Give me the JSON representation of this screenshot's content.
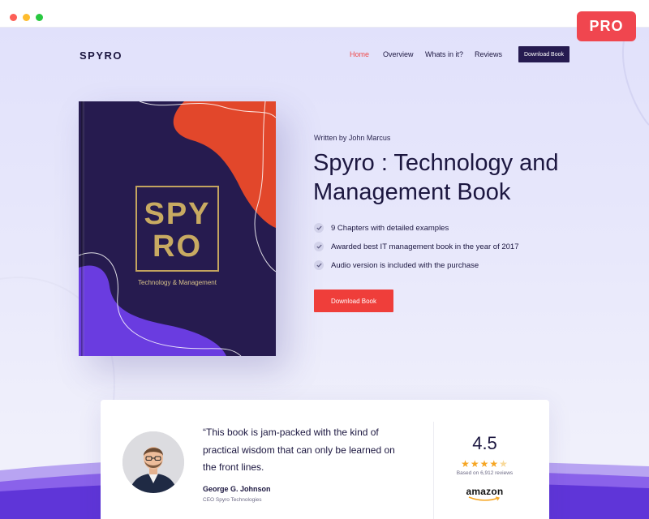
{
  "window": {
    "badge": "PRO"
  },
  "nav": {
    "logo": "SPYRO",
    "links": [
      {
        "label": "Home",
        "active": true
      },
      {
        "label": "Overview",
        "active": false
      },
      {
        "label": "Whats in it?",
        "active": false
      },
      {
        "label": "Reviews",
        "active": false
      }
    ],
    "cta_label": "Download Book"
  },
  "book": {
    "title_line1": "SPY",
    "title_line2": "RO",
    "subtitle": "Technology & Management"
  },
  "hero": {
    "written_by": "Written by John Marcus",
    "title": "Spyro : Technology and Management Book",
    "features": [
      "9 Chapters with detailed examples",
      "Awarded best IT management book in the year of 2017",
      "Audio version is included with the purchase"
    ],
    "cta_label": "Download Book"
  },
  "testimonial": {
    "quote": "“This book is jam-packed with the kind of practical wisdom that can only be learned on the front lines.",
    "author_name": "George G. Johnson",
    "author_role": "CEO Spyro Technologies",
    "rating": "4.5",
    "rating_value": 4.5,
    "rating_max": 5,
    "review_count": "Based on 6,912 reviews",
    "brand": "amazon"
  },
  "colors": {
    "accent_red": "#ef3e3a",
    "navy": "#261b50",
    "book_orange": "#e2472b",
    "book_purple": "#6a3ce0",
    "gold": "#c8aa62",
    "star": "#f6a623"
  }
}
